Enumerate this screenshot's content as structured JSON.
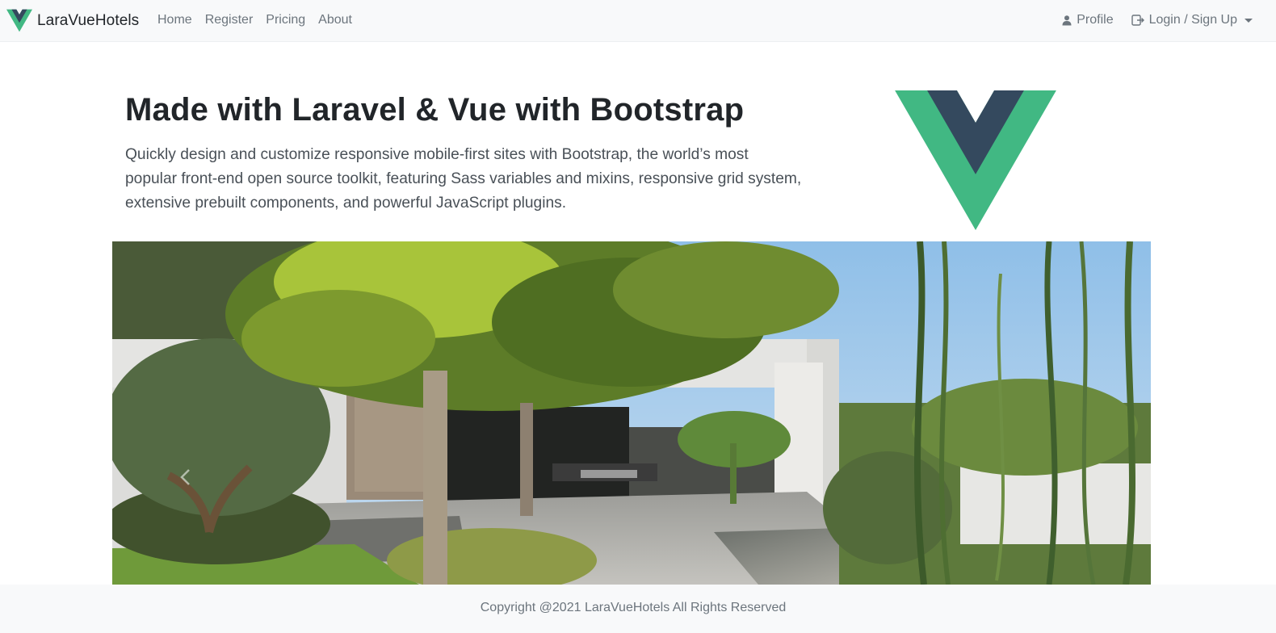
{
  "brand": {
    "name": "LaraVueHotels",
    "logo_icon": "vue-logo-icon"
  },
  "nav": {
    "left": [
      {
        "label": "Home"
      },
      {
        "label": "Register"
      },
      {
        "label": "Pricing"
      },
      {
        "label": "About"
      }
    ],
    "profile": {
      "label": "Profile",
      "icon": "person-icon"
    },
    "login": {
      "label": "Login / Sign Up",
      "icon": "login-icon"
    }
  },
  "hero": {
    "title": "Made with Laravel & Vue with Bootstrap",
    "lead": "Quickly design and customize responsive mobile-first sites with Bootstrap, the world’s most popular front-end open source toolkit, featuring Sass variables and mixins, responsive grid system, extensive prebuilt components, and powerful JavaScript plugins."
  },
  "carousel": {
    "prev_icon": "chevron-left-icon",
    "image": "garden-house-photo"
  },
  "footer": {
    "copyright": "Copyright @2021 LaraVueHotels All Rights Reserved"
  },
  "colors": {
    "vue_green": "#41b883",
    "vue_dark": "#34495e",
    "navbar_bg": "#f8f9fa",
    "muted_text": "#6c757d"
  }
}
